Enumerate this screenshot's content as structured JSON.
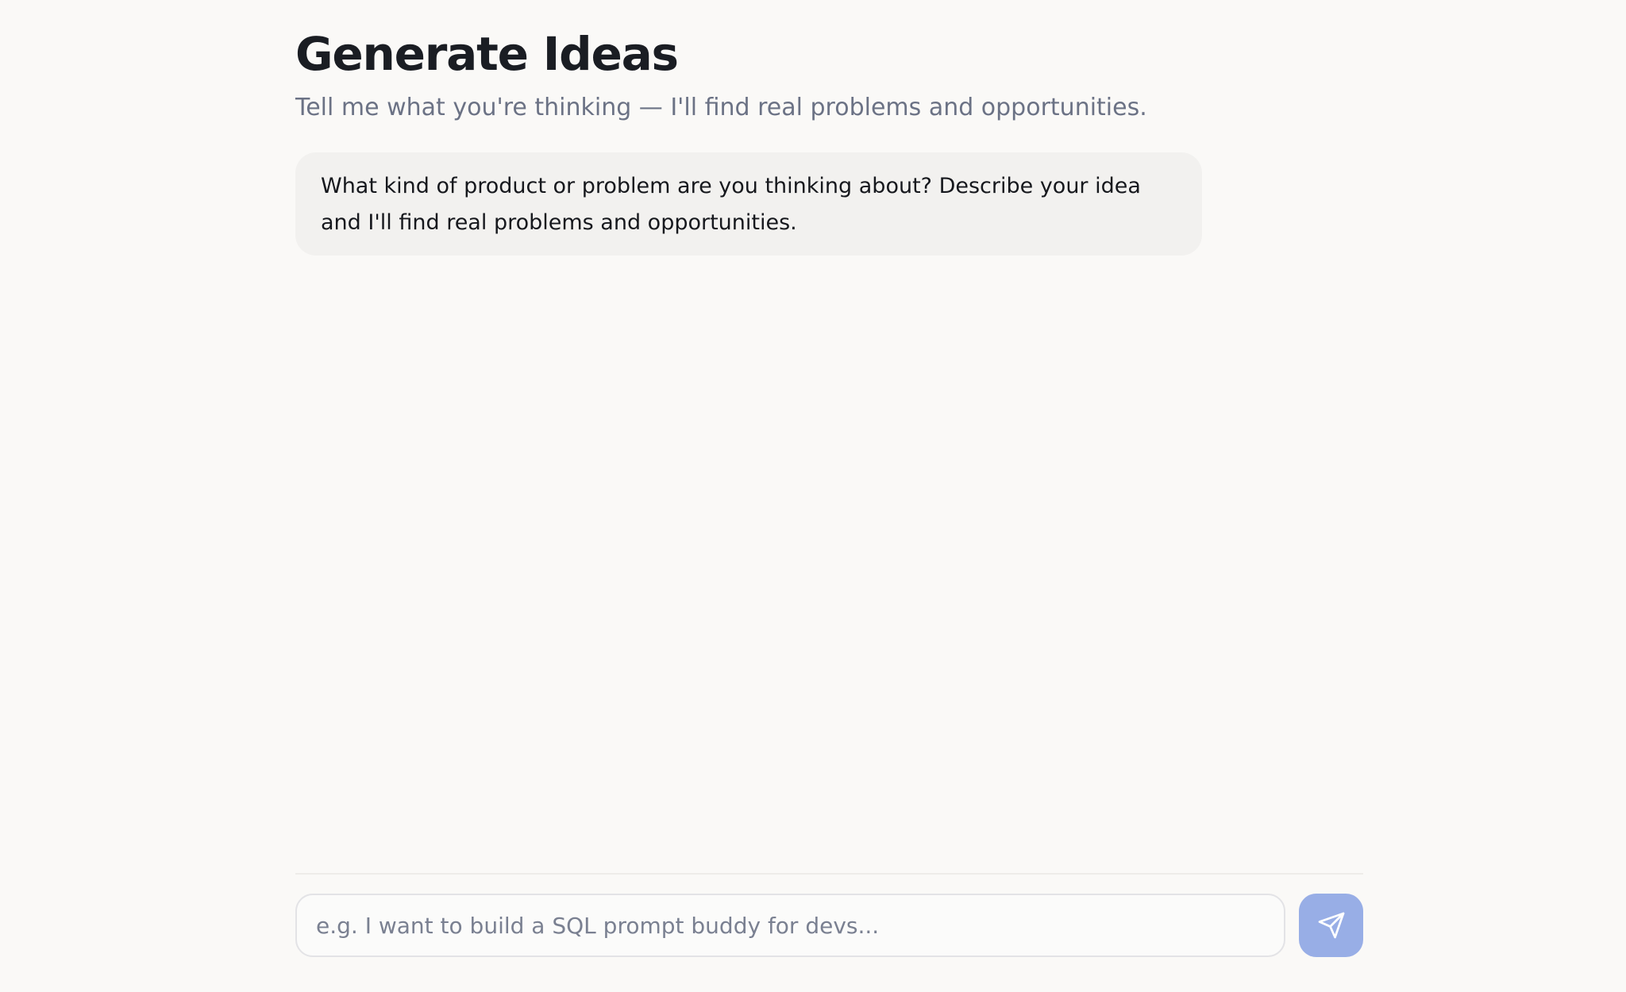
{
  "header": {
    "title": "Generate Ideas",
    "subtitle": "Tell me what you're thinking — I'll find real problems and opportunities."
  },
  "chat": {
    "messages": [
      {
        "role": "assistant",
        "text": "What kind of product or problem are you thinking about? Describe your idea and I'll find real problems and opportunities."
      }
    ]
  },
  "composer": {
    "value": "",
    "placeholder": "e.g. I want to build a SQL prompt buddy for devs...",
    "send_icon": "send-icon"
  },
  "colors": {
    "background": "#faf9f7",
    "bubble": "#f2f1ef",
    "accent": "#98aee6",
    "title_text": "#1a1d23",
    "muted_text": "#6b7285"
  }
}
